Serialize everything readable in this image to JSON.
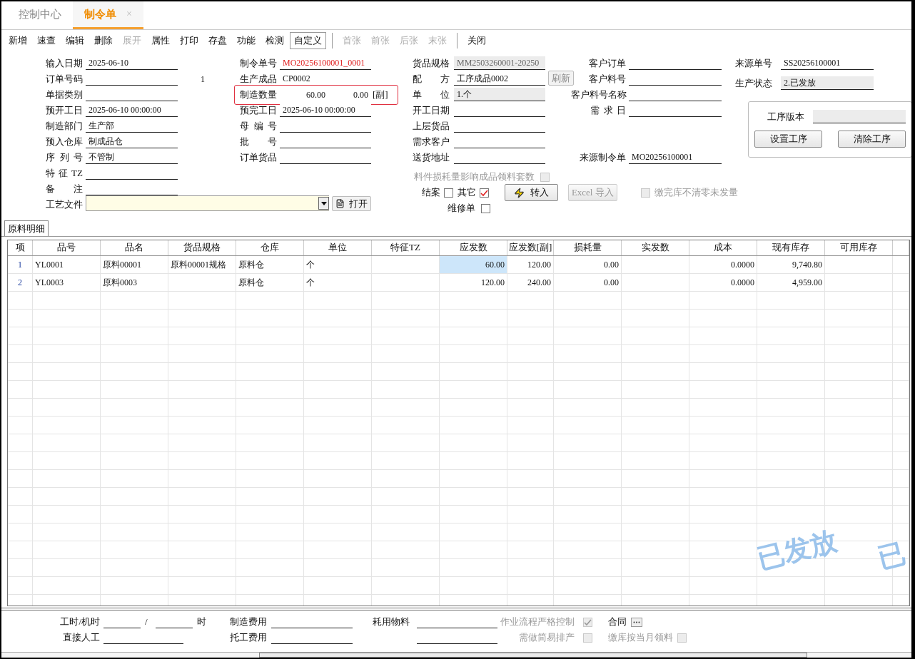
{
  "tabs": [
    {
      "label": "控制中心",
      "selected": false
    },
    {
      "label": "制令单",
      "selected": true,
      "close": "×"
    }
  ],
  "toolbar": {
    "groups": [
      [
        {
          "label": "新增",
          "disabled": false,
          "selected": false
        },
        {
          "label": "速查",
          "disabled": false,
          "selected": false
        },
        {
          "label": "编辑",
          "disabled": false,
          "selected": false
        },
        {
          "label": "删除",
          "disabled": false,
          "selected": false
        },
        {
          "label": "展开",
          "disabled": true,
          "selected": false
        },
        {
          "label": "属性",
          "disabled": false,
          "selected": false
        },
        {
          "label": "打印",
          "disabled": false,
          "selected": false
        },
        {
          "label": "存盘",
          "disabled": false,
          "selected": false
        },
        {
          "label": "功能",
          "disabled": false,
          "selected": false
        },
        {
          "label": "检测",
          "disabled": false,
          "selected": false
        },
        {
          "label": "自定义",
          "disabled": false,
          "selected": true
        }
      ],
      [
        {
          "label": "首张",
          "disabled": true,
          "selected": false
        },
        {
          "label": "前张",
          "disabled": true,
          "selected": false
        },
        {
          "label": "后张",
          "disabled": true,
          "selected": false
        },
        {
          "label": "末张",
          "disabled": true,
          "selected": false
        }
      ],
      [
        {
          "label": "关闭",
          "disabled": false,
          "selected": false
        }
      ]
    ]
  },
  "form": {
    "column_1": [
      {
        "label": "输入日期",
        "value": "2025-06-10"
      },
      {
        "label": "订单号码",
        "side": "1"
      },
      {
        "label": "单据类别"
      },
      {
        "label": "预开工日",
        "value": "2025-06-10 00:00:00"
      },
      {
        "label": "制造部门",
        "value": "生产部"
      },
      {
        "label": "预入仓库",
        "value": "制成品仓"
      },
      {
        "label": "序 列 号",
        "value": "不管制"
      },
      {
        "label": "特征TZ"
      },
      {
        "label": "备 注"
      }
    ],
    "column_2": [
      {
        "kind": "field",
        "label": "制令单号",
        "value": "MO20256100001_0001",
        "emphasis": true
      },
      {
        "kind": "field",
        "label": "生产成品",
        "value": "CP0002"
      },
      {
        "kind": "quantity",
        "label": "制造数量",
        "values": [
          "60.00",
          "0.00"
        ],
        "unit": "[副]",
        "highlighted": true
      },
      {
        "kind": "field",
        "label": "预完工日",
        "value": "2025-06-10 00:00:00"
      },
      {
        "kind": "field",
        "label": "母 编 号"
      },
      {
        "kind": "field",
        "label": "批 号"
      },
      {
        "kind": "field",
        "label": "订单货品"
      }
    ],
    "process_file": {
      "label": "工艺文件",
      "button": "打开"
    },
    "middle_rows": [
      {
        "left": {
          "label": "货品规格",
          "value": "MM2503260001-20250",
          "readonly": true
        },
        "right": {
          "label": "客户订单"
        }
      },
      {
        "left": {
          "label": "配 方",
          "value": "工序成品0002",
          "button": "刷新"
        },
        "right": {
          "label": "客户料号"
        }
      },
      {
        "left": {
          "label": "单 位",
          "value": "1.个",
          "readonly": true
        },
        "right": {
          "label": "客户料号名称"
        }
      },
      {
        "left": {
          "label": "开工日期"
        },
        "right": {
          "label": "需 求 日"
        }
      },
      {
        "left": {
          "label": "上层货品"
        }
      },
      {
        "left": {
          "label": "需求客户"
        }
      },
      {
        "left": {
          "label": "送货地址"
        },
        "right": {
          "label": "来源制令单",
          "value": "MO20256100001"
        }
      }
    ],
    "column_5": [
      {
        "label": "来源单号",
        "value": "SS20256100001",
        "readonly": false
      },
      {
        "label": "生产状态",
        "value": "2.已发放",
        "readonly": true
      }
    ],
    "process_panel": {
      "label": "工序版本",
      "buttons": [
        "设置工序",
        "清除工序"
      ]
    },
    "loss_option": {
      "label": "料件损耗量影响成品领料套数",
      "checked": false,
      "disabled": true
    },
    "closed": {
      "label": "结案",
      "checked": false,
      "disabled": false
    },
    "other": {
      "label": "其它",
      "checked": true,
      "disabled": false
    },
    "actions": [
      {
        "kind": "import",
        "label": "转入",
        "disabled": false
      },
      {
        "kind": "excel",
        "label": "Excel 导入",
        "disabled": true
      }
    ],
    "no_clear": {
      "label": "缴完库不清零未发量",
      "checked": false,
      "disabled": true
    },
    "repair": {
      "label": "维修单",
      "checked": false,
      "disabled": false
    }
  },
  "detail_tab": {
    "label": "原料明细",
    "selected": true
  },
  "table": {
    "columns": [
      {
        "label": "项",
        "kind": "index"
      },
      {
        "label": "品号",
        "kind": "text"
      },
      {
        "label": "品名",
        "kind": "text"
      },
      {
        "label": "货品规格",
        "kind": "text"
      },
      {
        "label": "仓库",
        "kind": "text"
      },
      {
        "label": "单位",
        "kind": "text"
      },
      {
        "label": "特征TZ",
        "kind": "text"
      },
      {
        "label": "应发数",
        "kind": "number"
      },
      {
        "label": "应发数[副]",
        "kind": "number"
      },
      {
        "label": "损耗量",
        "kind": "number"
      },
      {
        "label": "实发数",
        "kind": "number"
      },
      {
        "label": "成本",
        "kind": "number"
      },
      {
        "label": "现有库存",
        "kind": "number"
      },
      {
        "label": "可用库存",
        "kind": "number"
      }
    ],
    "rows": [
      {
        "cells": [
          {
            "text": "1",
            "selected": false
          },
          {
            "text": "YL0001",
            "selected": false
          },
          {
            "text": "原料00001",
            "selected": false
          },
          {
            "text": "原料00001规格",
            "selected": false
          },
          {
            "text": "原料仓",
            "selected": false
          },
          {
            "text": "个",
            "selected": false
          },
          {
            "selected": false
          },
          {
            "text": "60.00",
            "selected": true
          },
          {
            "text": "120.00",
            "selected": false
          },
          {
            "text": "0.00",
            "selected": false
          },
          {
            "selected": false
          },
          {
            "text": "0.0000",
            "selected": false
          },
          {
            "text": "9,740.80",
            "selected": false
          },
          {
            "selected": false
          }
        ]
      },
      {
        "cells": [
          {
            "text": "2",
            "selected": false
          },
          {
            "text": "YL0003",
            "selected": false
          },
          {
            "text": "原料0003",
            "selected": false
          },
          {
            "selected": false
          },
          {
            "text": "原料仓",
            "selected": false
          },
          {
            "text": "个",
            "selected": false
          },
          {
            "selected": false
          },
          {
            "text": "120.00",
            "selected": false
          },
          {
            "text": "240.00",
            "selected": false
          },
          {
            "text": "0.00",
            "selected": false
          },
          {
            "selected": false
          },
          {
            "text": "0.0000",
            "selected": false
          },
          {
            "text": "4,959.00",
            "selected": false
          },
          {
            "selected": false
          }
        ]
      }
    ]
  },
  "stamps": [
    "已发放",
    "已"
  ],
  "footer": {
    "hours": {
      "label": "工时/机时",
      "separator": "/",
      "unit": "时"
    },
    "labor": {
      "label": "直接人工"
    },
    "make_cost": {
      "label": "制造费用"
    },
    "outsource_cost": {
      "label": "托工费用"
    },
    "materials": {
      "label": "耗用物料"
    },
    "strict": {
      "label": "作业流程严格控制",
      "checked": true,
      "disabled": true
    },
    "contract": {
      "label": "合同"
    },
    "schedule": {
      "label": "需做简易排产",
      "checked": false,
      "disabled": true
    },
    "monthly": {
      "label": "缴库按当月领料",
      "checked": false,
      "disabled": true
    }
  }
}
